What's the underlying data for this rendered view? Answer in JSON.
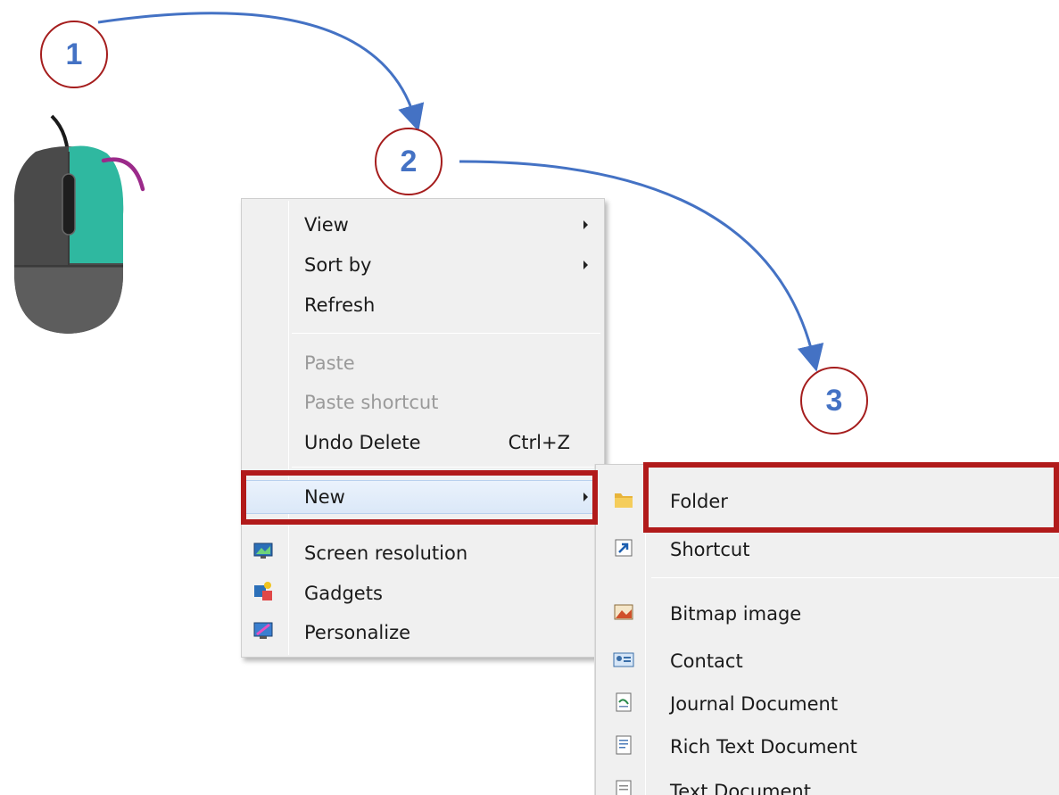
{
  "steps": [
    "1",
    "2",
    "3"
  ],
  "context_menu": {
    "items": [
      {
        "label": "View",
        "submenu": true
      },
      {
        "label": "Sort by",
        "submenu": true
      },
      {
        "label": "Refresh"
      },
      {
        "label": "Paste",
        "disabled": true
      },
      {
        "label": "Paste shortcut",
        "disabled": true
      },
      {
        "label": "Undo Delete",
        "shortcut": "Ctrl+Z"
      },
      {
        "label": "New",
        "submenu": true,
        "highlighted": true
      },
      {
        "label": "Screen resolution",
        "icon": "screen-resolution-icon"
      },
      {
        "label": "Gadgets",
        "icon": "gadgets-icon"
      },
      {
        "label": "Personalize",
        "icon": "personalize-icon"
      }
    ]
  },
  "new_menu": {
    "items": [
      {
        "label": "Folder",
        "icon": "folder-icon",
        "highlighted": true
      },
      {
        "label": "Shortcut",
        "icon": "shortcut-icon"
      },
      {
        "label": "Bitmap image",
        "icon": "bitmap-icon"
      },
      {
        "label": "Contact",
        "icon": "contact-icon"
      },
      {
        "label": "Journal Document",
        "icon": "journal-icon"
      },
      {
        "label": "Rich Text Document",
        "icon": "rich-text-icon"
      },
      {
        "label": "Text Document",
        "icon": "text-document-icon"
      }
    ]
  },
  "colors": {
    "step_number": "#4472c4",
    "step_border": "#a51d1d",
    "highlight_border": "#b11a1a",
    "arrow": "#4472c4",
    "mouse_body": "#4a4a4a",
    "mouse_button": "#2fb8a0",
    "click_arc": "#9b2a8a"
  }
}
